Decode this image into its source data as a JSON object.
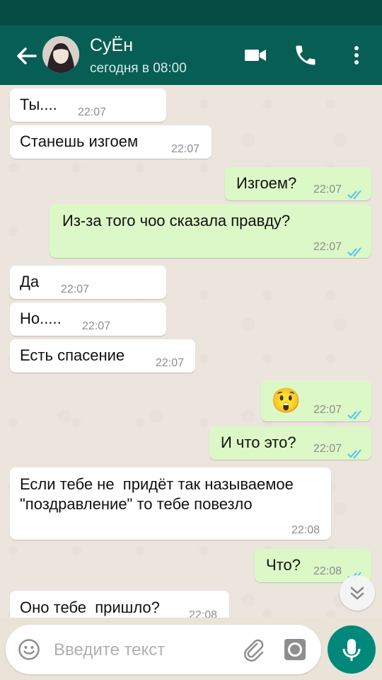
{
  "header": {
    "contact_name": "СуЁн",
    "last_seen": "сегодня в 08:00"
  },
  "messages": [
    {
      "dir": "in",
      "text": "Ты....",
      "time": "22:07"
    },
    {
      "dir": "in",
      "text": "Станешь изгоем",
      "time": "22:07"
    },
    {
      "dir": "out",
      "text": "Изгоем?",
      "time": "22:07",
      "status": "read"
    },
    {
      "dir": "out",
      "text": "Из-за того чоо сказала правду?",
      "time": "22:07",
      "status": "read"
    },
    {
      "dir": "in",
      "text": "Да",
      "time": "22:07"
    },
    {
      "dir": "in",
      "text": "Но.....",
      "time": "22:07"
    },
    {
      "dir": "in",
      "text": "Есть спасение",
      "time": "22:07"
    },
    {
      "dir": "out",
      "text": "😲",
      "time": "22:07",
      "status": "read"
    },
    {
      "dir": "out",
      "text": "И что это?",
      "time": "22:07",
      "status": "read"
    },
    {
      "dir": "in",
      "text": "Если тебе не  придёт так называемое\n\"поздравление\" то тебе повезло",
      "time": "22:08"
    },
    {
      "dir": "out",
      "text": "Что?",
      "time": "22:08",
      "status": "read"
    },
    {
      "dir": "in",
      "text": "Оно тебе  пришло?",
      "time": "22:08"
    }
  ],
  "composer": {
    "placeholder": "Введите текст"
  },
  "colors": {
    "appbar": "#075e54",
    "statusbar": "#054d44",
    "outgoing_bubble": "#dcf8c6",
    "incoming_bubble": "#ffffff",
    "read_ticks": "#4fc3f7",
    "mic_button": "#00897b"
  },
  "icons": {
    "back": "arrow-left-icon",
    "video": "video-camera-icon",
    "call": "phone-icon",
    "menu": "more-vertical-icon",
    "emoji": "smiley-icon",
    "attach": "paperclip-icon",
    "camera": "camera-icon",
    "mic": "microphone-icon",
    "scroll": "double-chevron-down-icon"
  }
}
